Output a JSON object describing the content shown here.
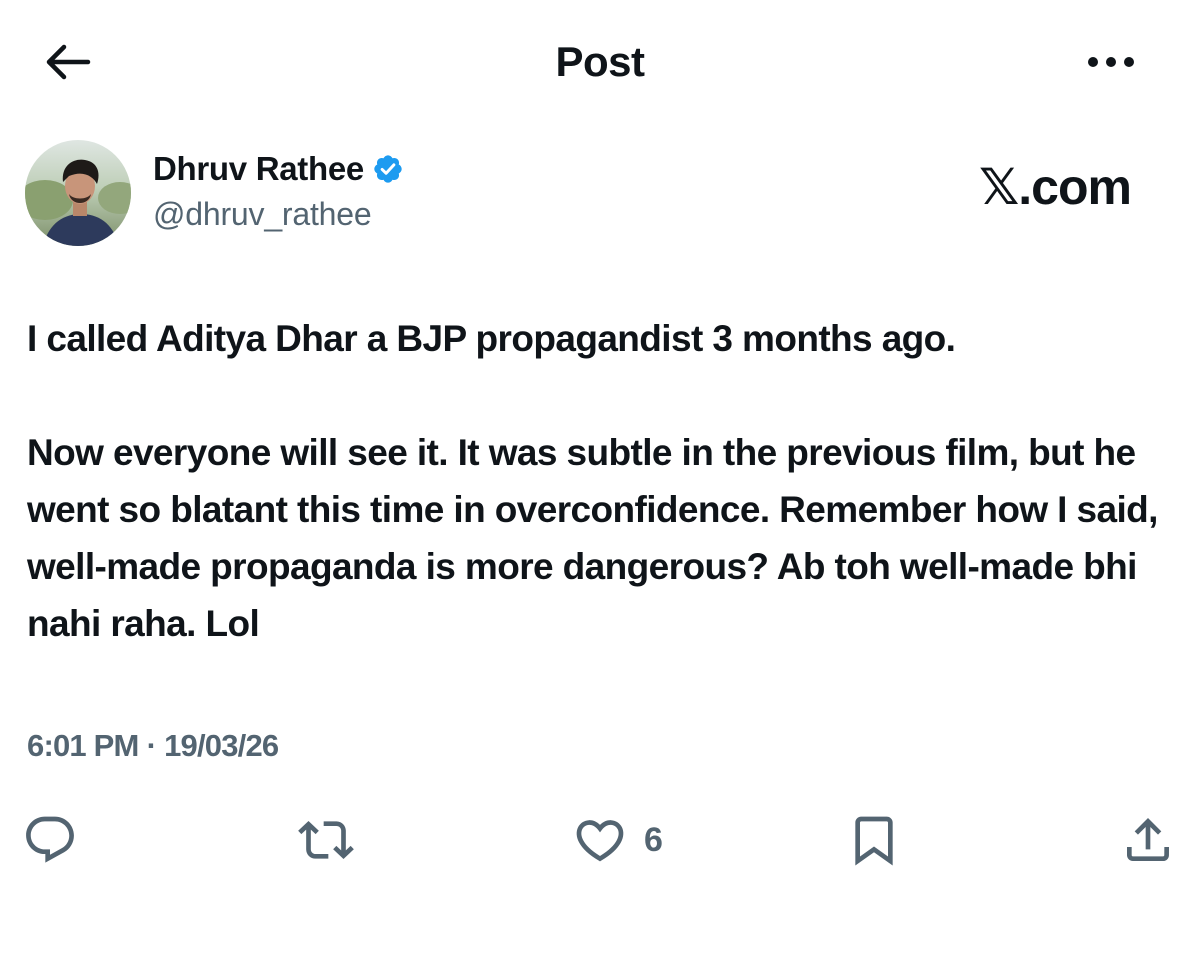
{
  "header": {
    "title": "Post",
    "back_icon": "back-arrow-icon",
    "more_icon": "more-options-icon"
  },
  "author": {
    "display_name": "Dhruv Rathee",
    "handle": "@dhruv_rathee",
    "verified": true,
    "verified_color": "#1d9bf0"
  },
  "watermark": "𝕏.com",
  "post": {
    "paragraphs": [
      "I called Aditya Dhar a BJP propagandist 3 months ago.",
      "Now everyone will see it. It was subtle in the previous film, but he went so blatant this time in overconfidence. Remember how I said, well-made propaganda is more dangerous? Ab toh well-made bhi nahi raha. Lol"
    ],
    "time": "6:01 PM",
    "separator": "·",
    "date": "19/03/26"
  },
  "actions": {
    "reply_icon": "reply-icon",
    "repost_icon": "repost-icon",
    "like_icon": "like-icon",
    "like_count": "6",
    "bookmark_icon": "bookmark-icon",
    "share_icon": "share-icon"
  },
  "colors": {
    "text": "#0f1419",
    "secondary_text": "#536471",
    "icon": "#536471"
  }
}
